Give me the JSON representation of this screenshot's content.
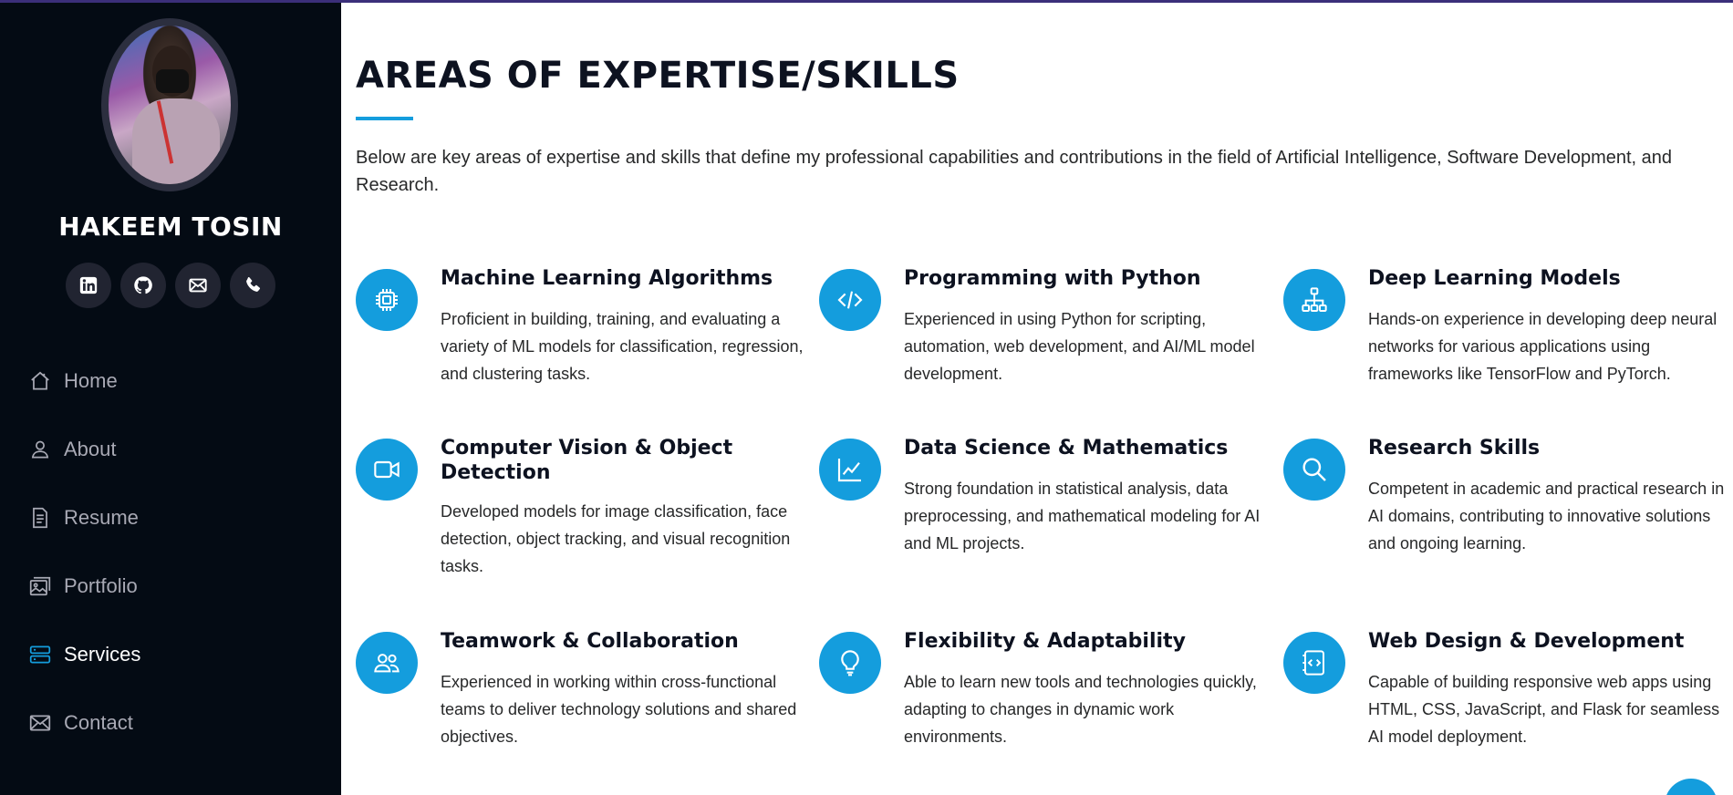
{
  "profile": {
    "name": "HAKEEM TOSIN",
    "socials": [
      {
        "icon": "linkedin-icon"
      },
      {
        "icon": "github-icon"
      },
      {
        "icon": "email-icon"
      },
      {
        "icon": "phone-icon"
      }
    ]
  },
  "nav": {
    "items": [
      {
        "label": "Home",
        "icon": "house-icon",
        "active": false
      },
      {
        "label": "About",
        "icon": "person-icon",
        "active": false
      },
      {
        "label": "Resume",
        "icon": "file-text-icon",
        "active": false
      },
      {
        "label": "Portfolio",
        "icon": "images-icon",
        "active": false
      },
      {
        "label": "Services",
        "icon": "hdd-stack-icon",
        "active": true
      },
      {
        "label": "Contact",
        "icon": "envelope-icon",
        "active": false
      }
    ]
  },
  "main": {
    "title": "AREAS OF EXPERTISE/SKILLS",
    "intro": "Below are key areas of expertise and skills that define my professional capabilities and contributions in the field of Artificial Intelligence, Software Development, and Research.",
    "skills": [
      {
        "title": "Machine Learning Algorithms",
        "icon": "cpu-icon",
        "desc": "Proficient in building, training, and evaluating a variety of ML models for classification, regression, and clustering tasks."
      },
      {
        "title": "Programming with Python",
        "icon": "code-icon",
        "desc": "Experienced in using Python for scripting, automation, web development, and AI/ML model development."
      },
      {
        "title": "Deep Learning Models",
        "icon": "diagram-icon",
        "desc": "Hands-on experience in developing deep neural networks for various applications using frameworks like TensorFlow and PyTorch."
      },
      {
        "title": "Computer Vision & Object Detection",
        "icon": "camera-video-icon",
        "desc": "Developed models for image classification, face detection, object tracking, and visual recognition tasks."
      },
      {
        "title": "Data Science & Mathematics",
        "icon": "graph-up-icon",
        "desc": "Strong foundation in statistical analysis, data preprocessing, and mathematical modeling for AI and ML projects."
      },
      {
        "title": "Research Skills",
        "icon": "search-icon",
        "desc": "Competent in academic and practical research in AI domains, contributing to innovative solutions and ongoing learning."
      },
      {
        "title": "Teamwork & Collaboration",
        "icon": "people-icon",
        "desc": "Experienced in working within cross-functional teams to deliver technology solutions and shared objectives."
      },
      {
        "title": "Flexibility & Adaptability",
        "icon": "lightbulb-icon",
        "desc": "Able to learn new tools and technologies quickly, adapting to changes in dynamic work environments."
      },
      {
        "title": "Web Design & Development",
        "icon": "file-code-icon",
        "desc": "Capable of building responsive web apps using HTML, CSS, JavaScript, and Flask for seamless AI model deployment."
      }
    ]
  },
  "colors": {
    "sidebar_bg": "#040b14",
    "accent": "#149ddd",
    "heading": "#0d1220",
    "nav_text": "#a8a9b4",
    "social_bg": "#212431"
  }
}
